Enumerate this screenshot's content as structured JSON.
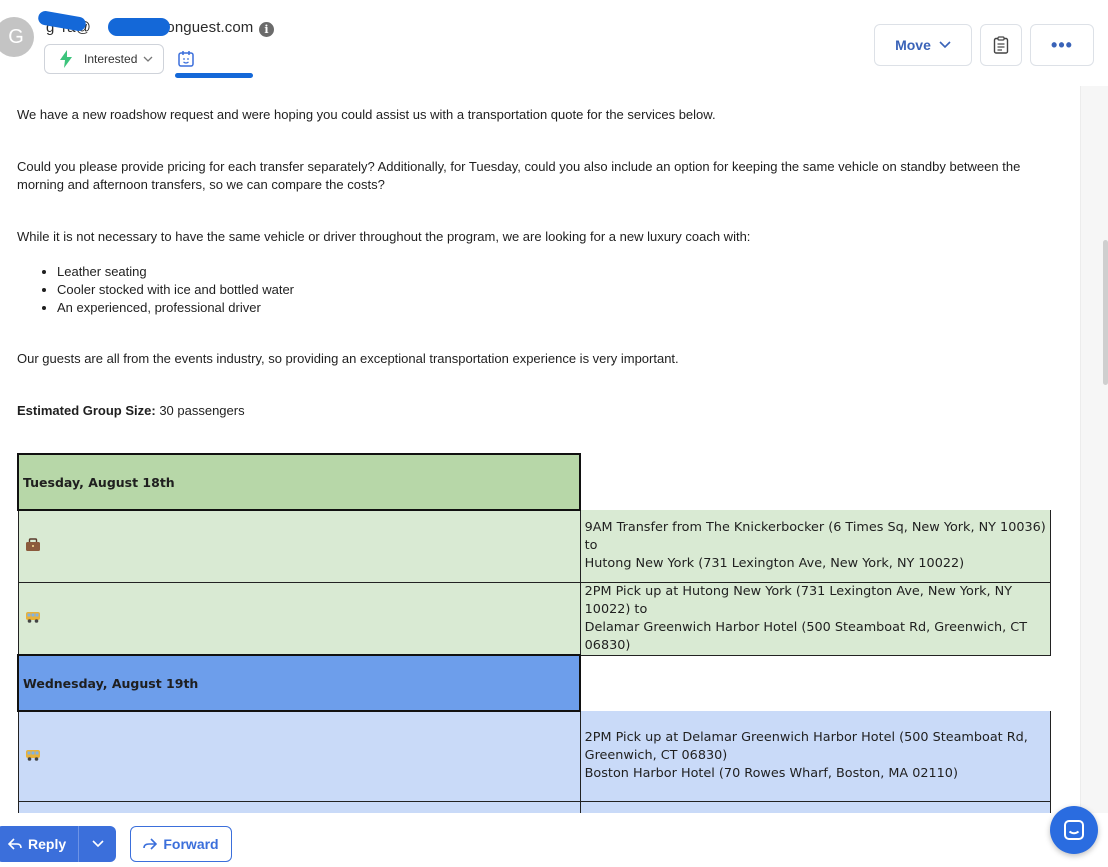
{
  "header": {
    "avatar_letter": "G",
    "sender_email": "g ra@     onguest.com",
    "status_label": "Interested",
    "move_label": "Move",
    "more_label": "•••"
  },
  "email": {
    "clipped_top": "",
    "p1": "We have a new roadshow request and were hoping you could assist us with a transportation quote for the services below.",
    "p2": "Could you please provide pricing for each transfer separately? Additionally, for Tuesday, could you also include an option for keeping the same vehicle on standby between the morning and afternoon transfers, so we can compare the costs?",
    "p3": "While it is not necessary to have the same vehicle or driver throughout the program, we are looking for a new luxury coach with:",
    "features": [
      "Leather seating",
      "Cooler stocked with ice and bottled water",
      "An experienced, professional driver"
    ],
    "p4": "Our guests are all from the events industry, so providing an exceptional transportation experience is very important.",
    "group_size_label": "Estimated Group Size:",
    "group_size_value": " 30 passengers"
  },
  "schedule": {
    "day1": {
      "label": "Tuesday, August 18th",
      "rows": [
        {
          "icon": "briefcase-icon",
          "line1": "9AM Transfer from The Knickerbocker (6 Times Sq, New York, NY 10036) to",
          "line2": "Hutong New York (731 Lexington Ave, New York, NY 10022)",
          "line3": ""
        },
        {
          "icon": "bus-icon",
          "line1": "2PM Pick up at Hutong New York (731 Lexington Ave, New York, NY 10022) to",
          "line2": "Delamar Greenwich Harbor Hotel (500 Steamboat Rd, Greenwich, CT 06830)",
          "line3": ""
        }
      ]
    },
    "day2": {
      "label": "Wednesday, August 19th",
      "rows": [
        {
          "icon": "bus-icon",
          "line1": "2PM Pick up at Delamar Greenwich Harbor Hotel (500 Steamboat Rd,",
          "line2": "Greenwich, CT 06830)",
          "line3": "Boston Harbor Hotel (70 Rowes Wharf, Boston, MA 02110)"
        }
      ]
    },
    "colors": {
      "green_head": "#b7d7a8",
      "green_row": "#d9ead3",
      "blue_head": "#6d9eeb",
      "blue_row": "#c9daf8"
    }
  },
  "footer": {
    "reply_label": "Reply",
    "forward_label": "Forward"
  },
  "colors": {
    "accent": "#3b6fdb",
    "redaction": "#1468d8"
  }
}
